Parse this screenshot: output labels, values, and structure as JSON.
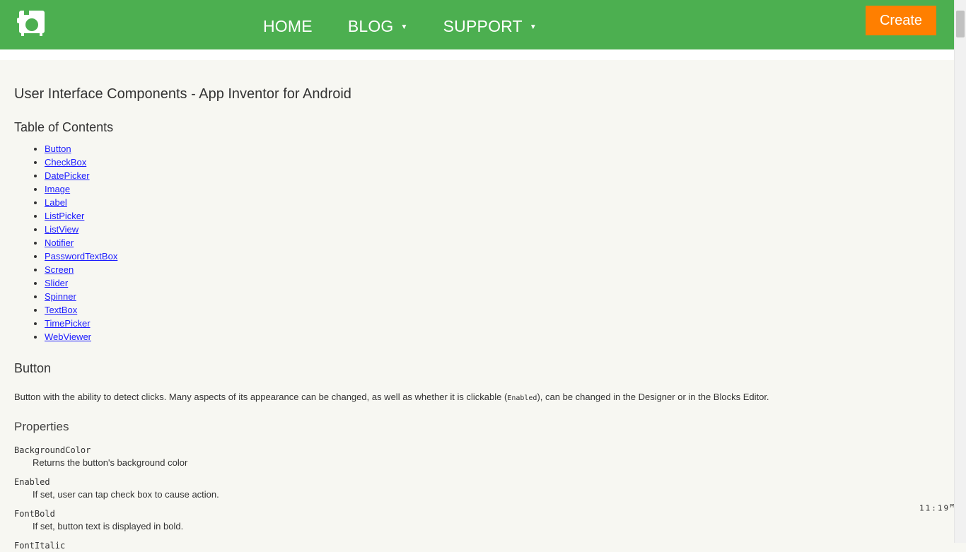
{
  "nav": {
    "links": [
      {
        "label": "HOME",
        "has_menu": false
      },
      {
        "label": "BLOG",
        "has_menu": true
      },
      {
        "label": "SUPPORT",
        "has_menu": true
      }
    ],
    "create_label": "Create",
    "caret": "▼"
  },
  "page": {
    "title": "User Interface Components - App Inventor for Android",
    "toc_title": "Table of Contents",
    "toc": [
      "Button",
      "CheckBox",
      "DatePicker",
      "Image",
      "Label",
      "ListPicker",
      "ListView",
      "Notifier",
      "PasswordTextBox",
      "Screen",
      "Slider",
      "Spinner",
      "TextBox",
      "TimePicker",
      "WebViewer"
    ],
    "button_section": {
      "title": "Button",
      "desc_before": "Button with the ability to detect clicks. Many aspects of its appearance can be changed, as well as whether it is clickable (",
      "desc_code": "Enabled",
      "desc_after": "), can be changed in the Designer or in the Blocks Editor.",
      "properties_title": "Properties",
      "properties": [
        {
          "name": "BackgroundColor",
          "desc": "Returns the button's background color"
        },
        {
          "name": "Enabled",
          "desc": "If set, user can tap check box to cause action."
        },
        {
          "name": "FontBold",
          "desc": "If set, button text is displayed in bold."
        },
        {
          "name": "FontItalic",
          "desc": ""
        }
      ]
    }
  },
  "clock": {
    "time": "11:19",
    "ampm": "PM"
  },
  "colors": {
    "nav_bg": "#4caf50",
    "create_bg": "#ff7f00",
    "link": "#1a1aff",
    "page_bg": "#f7f7f2"
  },
  "icons": {
    "logo": "app-inventor-logo-icon"
  }
}
